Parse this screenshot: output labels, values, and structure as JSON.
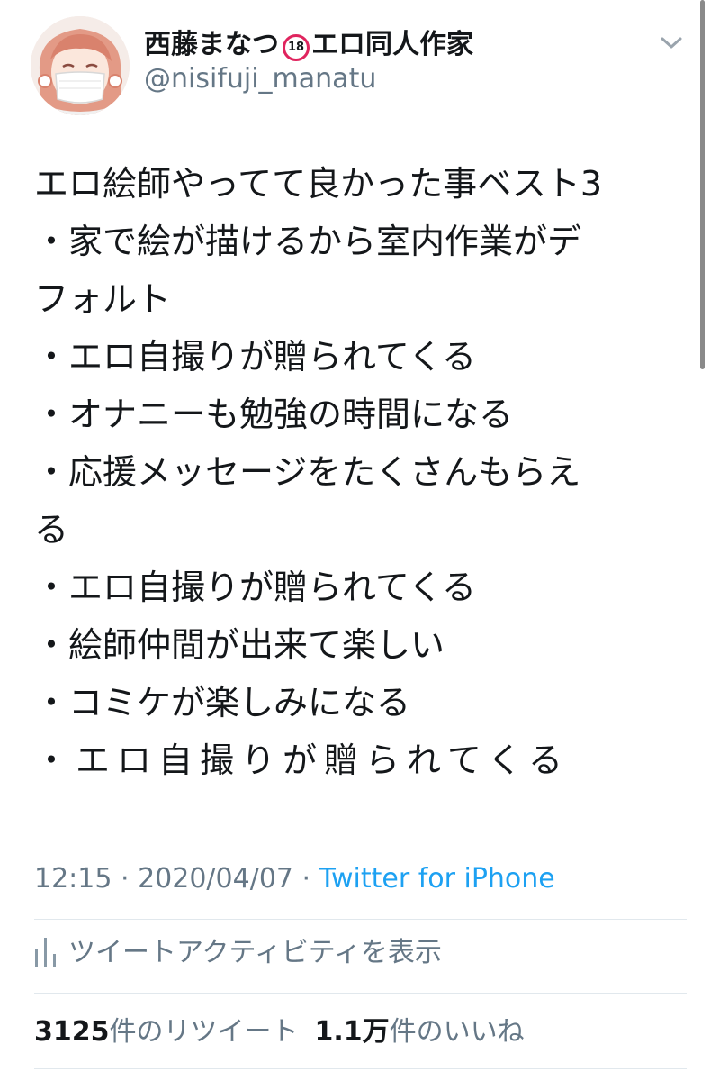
{
  "author": {
    "name_prefix": "西藤まなつ",
    "age_badge": "18",
    "name_suffix": "エロ同人作家",
    "handle": "@nisifuji_manatu"
  },
  "tweet": {
    "lines": [
      "エロ絵師やってて良かった事ベスト3",
      "・家で絵が描けるから室内作業がデ",
      "フォルト",
      "・エロ自撮りが贈られてくる",
      "・オナニーも勉強の時間になる",
      "・応援メッセージをたくさんもらえ",
      "る",
      "・エロ自撮りが贈られてくる",
      "・絵師仲間が出来て楽しい",
      "・コミケが楽しみになる",
      "・エロ自撮りが贈られてくる"
    ]
  },
  "meta": {
    "time": "12:15",
    "separator": " · ",
    "date": "2020/04/07",
    "source": "Twitter for iPhone"
  },
  "activity": {
    "label": "ツイートアクティビティを表示"
  },
  "stats": {
    "retweets_count": "3125",
    "retweets_label": "件のリツイート",
    "likes_count": "1.1万",
    "likes_label": "件のいいね"
  },
  "icons": {
    "menu": "chevron-down-icon",
    "activity": "bar-chart-icon",
    "badge": "age-18-icon"
  },
  "colors": {
    "link": "#1da1f2",
    "secondary_text": "#657786",
    "badge_ring": "#e0245e",
    "divider": "#e1e8ed"
  }
}
